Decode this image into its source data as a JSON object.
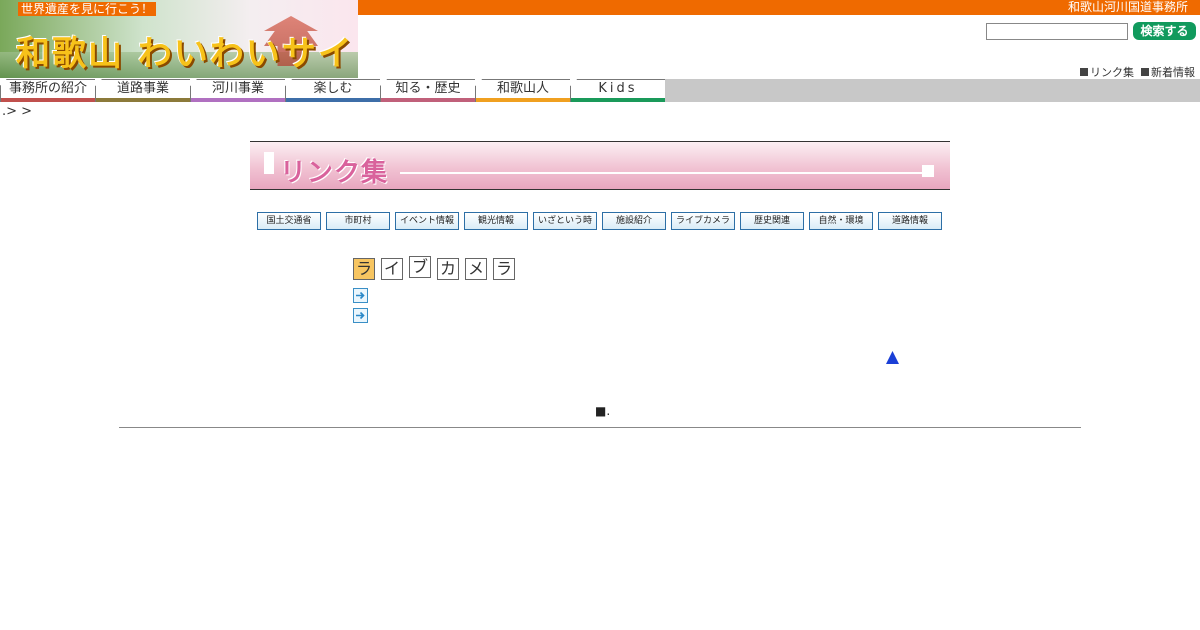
{
  "header": {
    "org_name": "和歌山河川国道事務所",
    "tagline": "世界遺産を見に行こう！",
    "logo_text": "和歌山 わいわいサイト"
  },
  "search": {
    "value": "",
    "button_label": "検索する"
  },
  "util_links": [
    {
      "label": "リンク集"
    },
    {
      "label": "新着情報"
    }
  ],
  "nav": {
    "tabs": [
      {
        "label": "事務所の紹介",
        "color": "#c0504d"
      },
      {
        "label": "道路事業",
        "color": "#8c7a3a"
      },
      {
        "label": "河川事業",
        "color": "#b070c0"
      },
      {
        "label": "楽しむ",
        "color": "#3d6ea8"
      },
      {
        "label": "知る・歴史",
        "color": "#c0607a"
      },
      {
        "label": "和歌山人",
        "color": "#f0a020"
      },
      {
        "label": "Kids",
        "color": "#1a9a5a"
      }
    ]
  },
  "breadcrumb": ".> >",
  "page": {
    "title": "リンク集",
    "categories": [
      {
        "label": "国土交通省"
      },
      {
        "label": "市町村"
      },
      {
        "label": "イベント情報"
      },
      {
        "label": "観光情報"
      },
      {
        "label": "いざという時"
      },
      {
        "label": "施設紹介"
      },
      {
        "label": "ライブカメラ"
      },
      {
        "label": "歴史関連"
      },
      {
        "label": "自然・環境"
      },
      {
        "label": "道路情報"
      }
    ],
    "section_heading": [
      "ラ",
      "イ",
      "ブ",
      "カ",
      "メ",
      "ラ"
    ],
    "footer_mark": "■."
  },
  "icons": {
    "link_arrow": "arrow-right-icon",
    "to_top": "triangle-up-icon"
  },
  "colors": {
    "top_bar": "#ef6a00",
    "search_button": "#119a5d",
    "banner_title": "#d9629c",
    "to_top": "#1a3fd6"
  }
}
